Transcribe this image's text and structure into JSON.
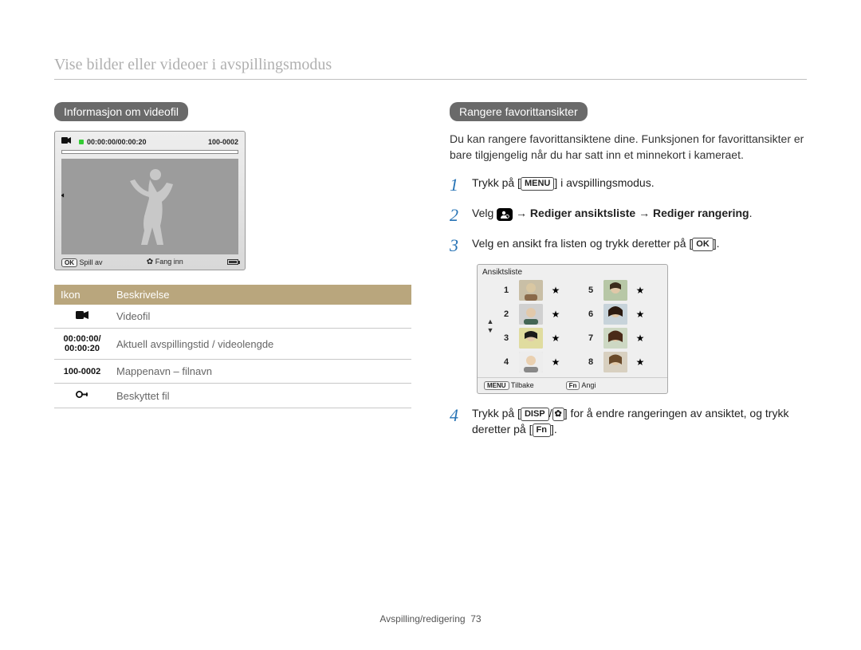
{
  "top_title": "Vise bilder eller videoer i avspillingsmodus",
  "left": {
    "pill": "Informasjon om videofil",
    "preview": {
      "time": "00:00:00/00:00:20",
      "folder_file": "100-0002",
      "ok_label": "OK",
      "play_label": "Spill av",
      "capture_label": "Fang inn"
    },
    "table": {
      "head_icon": "Ikon",
      "head_desc": "Beskrivelse",
      "rows": [
        {
          "icon_type": "videocam",
          "icon_text": "",
          "desc": "Videofil"
        },
        {
          "icon_type": "text",
          "icon_text_top": "00:00:00/",
          "icon_text_bot": "00:00:20",
          "desc": "Aktuell avspillingstid / videolengde"
        },
        {
          "icon_type": "text",
          "icon_text": "100-0002",
          "desc": "Mappenavn – filnavn"
        },
        {
          "icon_type": "lock",
          "icon_text": "",
          "desc": "Beskyttet fil"
        }
      ]
    }
  },
  "right": {
    "pill": "Rangere favorittansikter",
    "intro": "Du kan rangere favorittansiktene dine. Funksjonen for favorittansikter er bare tilgjengelig når du har satt inn et minnekort i kameraet.",
    "steps": {
      "s1_a": "Trykk på [",
      "s1_btn": "MENU",
      "s1_b": "] i avspillingsmodus.",
      "s2_a": "Velg ",
      "s2_b": " → ",
      "s2_c": "Rediger ansiktsliste",
      "s2_d": " → ",
      "s2_e": "Rediger rangering",
      "s2_f": ".",
      "s3_a": "Velg en ansikt fra listen og trykk deretter på [",
      "s3_btn": "OK",
      "s3_b": "].",
      "s4_a": "Trykk på [",
      "s4_btn1": "DISP",
      "s4_slash": "/",
      "s4_b": "] for å endre rangeringen av ansiktet, og trykk deretter på [",
      "s4_btn2": "Fn",
      "s4_c": "]."
    },
    "face_panel": {
      "title": "Ansiktsliste",
      "ranks_left": [
        "1",
        "2",
        "3",
        "4"
      ],
      "ranks_right": [
        "5",
        "6",
        "7",
        "8"
      ],
      "menu_btn": "MENU",
      "menu_label": "Tilbake",
      "fn_btn": "Fn",
      "fn_label": "Angi"
    }
  },
  "footer": {
    "section": "Avspilling/redigering",
    "page": "73"
  }
}
